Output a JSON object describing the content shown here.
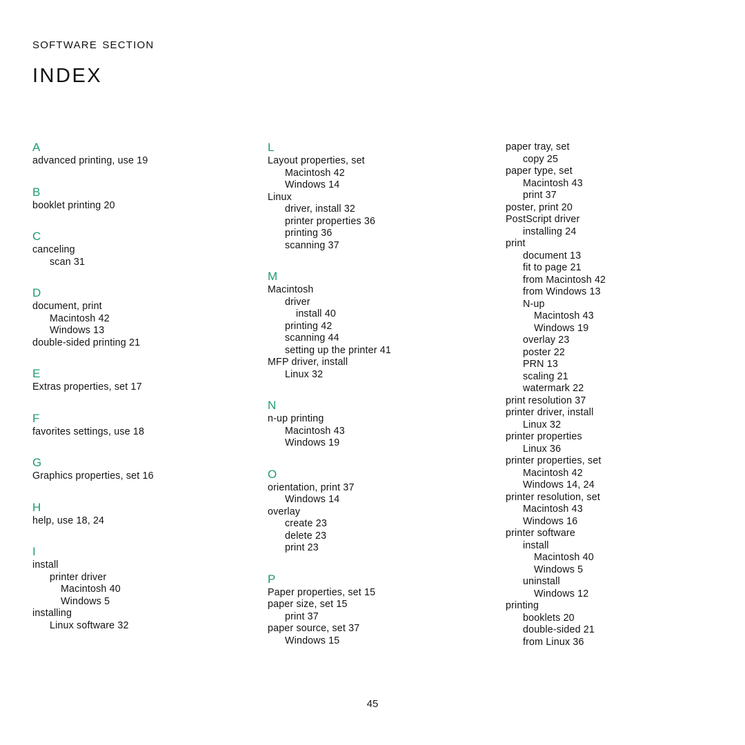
{
  "header": {
    "section_label": "Software section",
    "title": "Index"
  },
  "footer": {
    "page_number": "45"
  },
  "colors": {
    "letter_heading": "#1f9b72",
    "body_text": "#131313",
    "background": "#ffffff"
  },
  "columns": [
    {
      "name": "column-1",
      "groups": [
        {
          "letter": "A",
          "entries": [
            {
              "text": "advanced printing, use 19",
              "level": 0
            }
          ]
        },
        {
          "letter": "B",
          "entries": [
            {
              "text": "booklet printing 20",
              "level": 0
            }
          ]
        },
        {
          "letter": "C",
          "entries": [
            {
              "text": "canceling",
              "level": 0
            },
            {
              "text": "scan 31",
              "level": 1
            }
          ]
        },
        {
          "letter": "D",
          "entries": [
            {
              "text": "document, print",
              "level": 0
            },
            {
              "text": "Macintosh 42",
              "level": 1
            },
            {
              "text": "Windows 13",
              "level": 1
            },
            {
              "text": "double-sided printing 21",
              "level": 0
            }
          ]
        },
        {
          "letter": "E",
          "entries": [
            {
              "text": "Extras properties, set 17",
              "level": 0
            }
          ]
        },
        {
          "letter": "F",
          "entries": [
            {
              "text": "favorites settings, use 18",
              "level": 0
            }
          ]
        },
        {
          "letter": "G",
          "entries": [
            {
              "text": "Graphics properties, set 16",
              "level": 0
            }
          ]
        },
        {
          "letter": "H",
          "entries": [
            {
              "text": "help, use 18, 24",
              "level": 0
            }
          ]
        },
        {
          "letter": "I",
          "entries": [
            {
              "text": "install",
              "level": 0
            },
            {
              "text": "printer driver",
              "level": 1
            },
            {
              "text": "Macintosh 40",
              "level": 2
            },
            {
              "text": "Windows 5",
              "level": 2
            },
            {
              "text": "installing",
              "level": 0
            },
            {
              "text": "Linux software 32",
              "level": 1
            }
          ]
        }
      ]
    },
    {
      "name": "column-2",
      "groups": [
        {
          "letter": "L",
          "entries": [
            {
              "text": "Layout properties, set",
              "level": 0
            },
            {
              "text": "Macintosh 42",
              "level": 1
            },
            {
              "text": "Windows 14",
              "level": 1
            },
            {
              "text": "Linux",
              "level": 0
            },
            {
              "text": "driver, install 32",
              "level": 1
            },
            {
              "text": "printer properties 36",
              "level": 1
            },
            {
              "text": "printing 36",
              "level": 1
            },
            {
              "text": "scanning 37",
              "level": 1
            }
          ]
        },
        {
          "letter": "M",
          "entries": [
            {
              "text": "Macintosh",
              "level": 0
            },
            {
              "text": "driver",
              "level": 1
            },
            {
              "text": "install 40",
              "level": 2
            },
            {
              "text": "printing 42",
              "level": 1
            },
            {
              "text": "scanning 44",
              "level": 1
            },
            {
              "text": "setting up the printer 41",
              "level": 1
            },
            {
              "text": "MFP driver, install",
              "level": 0
            },
            {
              "text": "Linux 32",
              "level": 1
            }
          ]
        },
        {
          "letter": "N",
          "entries": [
            {
              "text": "n-up printing",
              "level": 0
            },
            {
              "text": "Macintosh 43",
              "level": 1
            },
            {
              "text": "Windows 19",
              "level": 1
            }
          ]
        },
        {
          "letter": "O",
          "entries": [
            {
              "text": "orientation, print 37",
              "level": 0
            },
            {
              "text": "Windows 14",
              "level": 1
            },
            {
              "text": "overlay",
              "level": 0
            },
            {
              "text": "create 23",
              "level": 1
            },
            {
              "text": "delete 23",
              "level": 1
            },
            {
              "text": "print 23",
              "level": 1
            }
          ]
        },
        {
          "letter": "P",
          "entries": [
            {
              "text": "Paper properties, set 15",
              "level": 0
            },
            {
              "text": "paper size, set 15",
              "level": 0
            },
            {
              "text": "print 37",
              "level": 1
            },
            {
              "text": "paper source, set 37",
              "level": 0
            },
            {
              "text": "Windows 15",
              "level": 1
            }
          ]
        }
      ]
    },
    {
      "name": "column-3",
      "groups": [
        {
          "letter": "",
          "entries": [
            {
              "text": "paper tray, set",
              "level": 0
            },
            {
              "text": "copy 25",
              "level": 1
            },
            {
              "text": "paper type, set",
              "level": 0
            },
            {
              "text": "Macintosh 43",
              "level": 1
            },
            {
              "text": "print 37",
              "level": 1
            },
            {
              "text": "poster, print 20",
              "level": 0
            },
            {
              "text": "PostScript driver",
              "level": 0
            },
            {
              "text": "installing 24",
              "level": 1
            },
            {
              "text": "print",
              "level": 0
            },
            {
              "text": "document 13",
              "level": 1
            },
            {
              "text": "fit to page 21",
              "level": 1
            },
            {
              "text": "from Macintosh 42",
              "level": 1
            },
            {
              "text": "from Windows 13",
              "level": 1
            },
            {
              "text": "N-up",
              "level": 1
            },
            {
              "text": "Macintosh 43",
              "level": 2
            },
            {
              "text": "Windows 19",
              "level": 2
            },
            {
              "text": "overlay 23",
              "level": 1
            },
            {
              "text": "poster 22",
              "level": 1
            },
            {
              "text": "PRN 13",
              "level": 1
            },
            {
              "text": "scaling 21",
              "level": 1
            },
            {
              "text": "watermark 22",
              "level": 1
            },
            {
              "text": "print resolution 37",
              "level": 0
            },
            {
              "text": "printer driver, install",
              "level": 0
            },
            {
              "text": "Linux 32",
              "level": 1
            },
            {
              "text": "printer properties",
              "level": 0
            },
            {
              "text": "Linux 36",
              "level": 1
            },
            {
              "text": "printer properties, set",
              "level": 0
            },
            {
              "text": "Macintosh 42",
              "level": 1
            },
            {
              "text": "Windows 14, 24",
              "level": 1
            },
            {
              "text": "printer resolution, set",
              "level": 0
            },
            {
              "text": "Macintosh 43",
              "level": 1
            },
            {
              "text": "Windows 16",
              "level": 1
            },
            {
              "text": "printer software",
              "level": 0
            },
            {
              "text": "install",
              "level": 1
            },
            {
              "text": "Macintosh 40",
              "level": 2
            },
            {
              "text": "Windows 5",
              "level": 2
            },
            {
              "text": "uninstall",
              "level": 1
            },
            {
              "text": "Windows 12",
              "level": 2
            },
            {
              "text": "printing",
              "level": 0
            },
            {
              "text": "booklets 20",
              "level": 1
            },
            {
              "text": "double-sided 21",
              "level": 1
            },
            {
              "text": "from Linux 36",
              "level": 1
            }
          ]
        }
      ]
    }
  ]
}
